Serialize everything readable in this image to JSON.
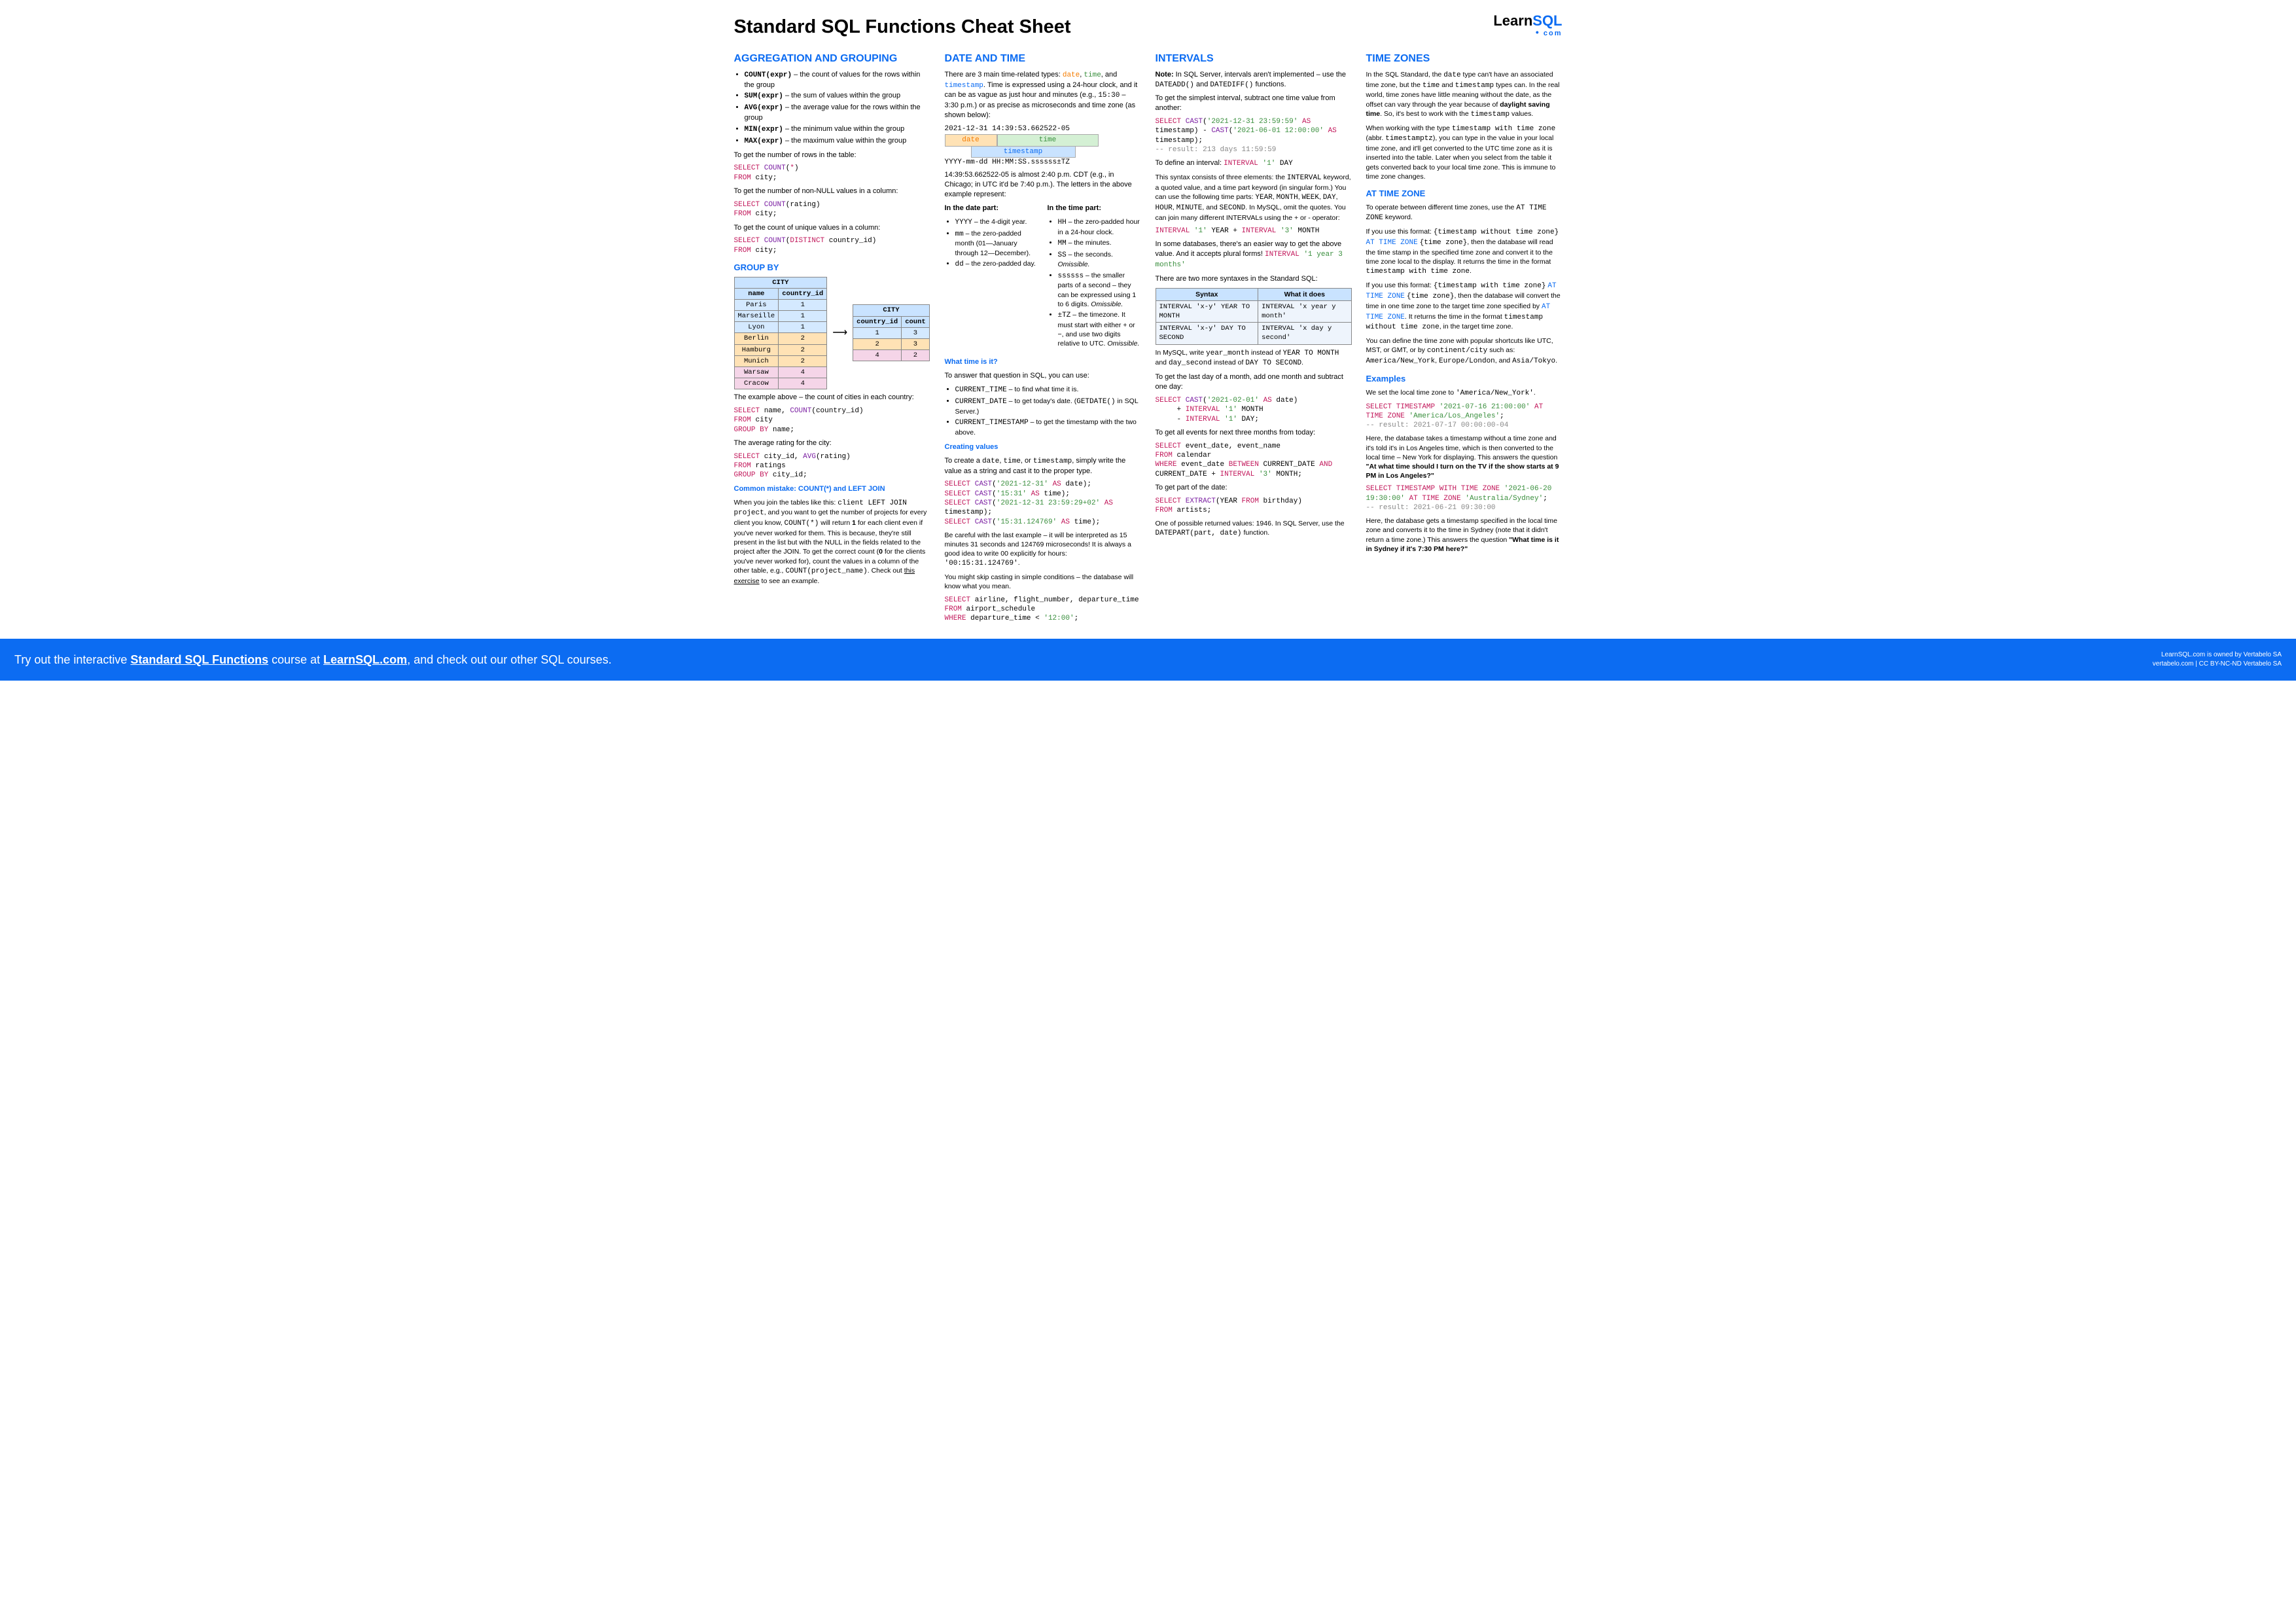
{
  "title": "Standard SQL Functions Cheat Sheet",
  "logo": {
    "learn": "Learn",
    "sql": "SQL",
    "com": "com"
  },
  "col1": {
    "h": "AGGREGATION AND GROUPING",
    "aggs": [
      {
        "fn": "COUNT(expr)",
        "d": " – the count of values for the rows within the group"
      },
      {
        "fn": "SUM(expr)",
        "d": " – the sum of values within the group"
      },
      {
        "fn": "AVG(expr)",
        "d": " – the average value for the rows within the group"
      },
      {
        "fn": "MIN(expr)",
        "d": " – the minimum value within the group"
      },
      {
        "fn": "MAX(expr)",
        "d": " – the maximum value within the group"
      }
    ],
    "p1": "To get the number of rows in the table:",
    "code1": "SELECT COUNT(*)\nFROM city;",
    "p2": "To get the number of non-NULL values in a column:",
    "code2": "SELECT COUNT(rating)\nFROM city;",
    "p3": "To get the count of unique values in a column:",
    "code3": "SELECT COUNT(DISTINCT country_id)\nFROM city;",
    "groupby_h": "GROUP BY",
    "city_h": "CITY",
    "name_h": "name",
    "cid_h": "country_id",
    "cnt_h": "count",
    "cities": [
      {
        "n": "Paris",
        "c": "1"
      },
      {
        "n": "Marseille",
        "c": "1"
      },
      {
        "n": "Lyon",
        "c": "1"
      },
      {
        "n": "Berlin",
        "c": "2"
      },
      {
        "n": "Hamburg",
        "c": "2"
      },
      {
        "n": "Munich",
        "c": "2"
      },
      {
        "n": "Warsaw",
        "c": "4"
      },
      {
        "n": "Cracow",
        "c": "4"
      }
    ],
    "grouped": [
      {
        "c": "1",
        "n": "3"
      },
      {
        "c": "2",
        "n": "3"
      },
      {
        "c": "4",
        "n": "2"
      }
    ],
    "p4": "The example above – the count of cities in each country:",
    "code4": "SELECT name, COUNT(country_id)\nFROM city\nGROUP BY name;",
    "p5": "The average rating for the city:",
    "code5": "SELECT city_id, AVG(rating)\nFROM ratings\nGROUP BY city_id;",
    "cm_h": "Common mistake: COUNT(*) and LEFT JOIN",
    "cm": "When you join the tables like this: client LEFT JOIN project, and you want to get the number of projects for every client you know, COUNT(*) will return 1 for each client even if you've never worked for them. This is because, they're still present in the list but with the NULL in the fields related to the project after the JOIN. To get the correct count (0 for the clients you've never worked for), count the values in a column of the other table, e.g., COUNT(project_name). Check out this exercise to see an example."
  },
  "col2": {
    "h": "DATE AND TIME",
    "intro": "There are 3 main time-related types: date, time, and timestamp. Time is expressed using a 24-hour clock, and it can be as vague as just hour and minutes (e.g., 15:30 – 3:30 p.m.) or as precise as microseconds and time zone (as shown below):",
    "ts": "2021-12-31 14:39:53.662522-05",
    "tsf": "YYYY-mm-dd HH:MM:SS.ssssss±TZ",
    "box": {
      "d": "date",
      "t": "time",
      "ts": "timestamp"
    },
    "p1": "14:39:53.662522-05 is almost 2:40 p.m. CDT (e.g., in Chicago; in UTC it'd be 7:40 p.m.). The letters in the above example represent:",
    "dp_h": "In the date part:",
    "tp_h": "In the time part:",
    "dp": [
      "YYYY – the 4-digit year.",
      "mm – the zero-padded month (01—January through 12—December).",
      "dd – the zero-padded day."
    ],
    "tp": [
      "HH – the zero-padded hour in a 24-hour clock.",
      "MM – the minutes.",
      "SS – the seconds. Omissible.",
      "ssssss – the smaller parts of a second – they can be expressed using 1 to 6 digits. Omissible.",
      "±TZ – the timezone. It must start with either + or −, and use two digits relative to UTC. Omissible."
    ],
    "wt_h": "What time is it?",
    "wt_p": "To answer that question in SQL, you can use:",
    "wt": [
      "CURRENT_TIME – to find what time it is.",
      "CURRENT_DATE – to get today's date. (GETDATE() in SQL Server.)",
      "CURRENT_TIMESTAMP – to get the timestamp with the two above."
    ],
    "cv_h": "Creating values",
    "cv_p": "To create a date, time, or timestamp, simply write the value as a string and cast it to the proper type.",
    "cv_code": "SELECT CAST('2021-12-31' AS date);\nSELECT CAST('15:31' AS time);\nSELECT CAST('2021-12-31 23:59:29+02' AS timestamp);\nSELECT CAST('15:31.124769' AS time);",
    "cv_p2": "Be careful with the last example – it will be interpreted as 15 minutes 31 seconds and 124769 microseconds! It is always a good idea to write 00 explicitly for hours: '00:15:31.124769'.",
    "cv_p3": "You might skip casting in simple conditions – the database will know what you mean.",
    "cv_code2": "SELECT airline, flight_number, departure_time\nFROM airport_schedule\nWHERE departure_time < '12:00';"
  },
  "col3": {
    "h": "INTERVALs",
    "note": "Note: In SQL Server, intervals aren't implemented – use the DATEADD() and DATEDIFF() functions.",
    "p1": "To get the simplest interval, subtract one time value from another:",
    "code1": "SELECT CAST('2021-12-31 23:59:59' AS timestamp) - CAST('2021-06-01 12:00:00' AS timestamp);\n-- result: 213 days 11:59:59",
    "p2a": "To define an interval:  ",
    "p2b": "INTERVAL '1' DAY",
    "p2": "This syntax consists of three elements: the INTERVAL keyword, a quoted value, and a time part keyword (in singular form.) You can use the following time parts: YEAR, MONTH, WEEK, DAY, HOUR, MINUTE, and SECOND. In MySQL, omit the quotes. You can join many different INTERVALs using the + or - operator:",
    "code2": "INTERVAL '1' YEAR + INTERVAL '3' MONTH",
    "p3": "In some databases, there's an easier way to get the above value. And it accepts plural forms! ",
    "code3": "INTERVAL '1 year 3 months'",
    "p4": "There are two more syntaxes in the Standard SQL:",
    "syn_h1": "Syntax",
    "syn_h2": "What it does",
    "syn": [
      {
        "a": "INTERVAL 'x-y' YEAR TO MONTH",
        "b": "INTERVAL 'x year y month'"
      },
      {
        "a": "INTERVAL 'x-y' DAY TO SECOND",
        "b": "INTERVAL 'x day y second'"
      }
    ],
    "p5": "In MySQL, write year_month instead of YEAR TO MONTH and day_second instead of DAY TO SECOND.",
    "p6": "To get the last day of a month, add one month and subtract one day:",
    "code6": "SELECT CAST('2021-02-01' AS date)\n     + INTERVAL '1' MONTH\n     - INTERVAL '1' DAY;",
    "p7": "To get all events for next three months from today:",
    "code7": "SELECT event_date, event_name\nFROM calendar\nWHERE event_date BETWEEN CURRENT_DATE AND CURRENT_DATE + INTERVAL '3' MONTH;",
    "p8": "To get part of the date:",
    "code8": "SELECT EXTRACT(YEAR FROM birthday)\nFROM artists;",
    "p9": "One of possible returned values: 1946. In SQL Server, use the DATEPART(part, date) function."
  },
  "col4": {
    "h": "TIME ZONES",
    "p1": "In the SQL Standard, the date type can't have an associated time zone, but the time and timestamp types can. In the real world, time zones have little meaning without the date, as the offset can vary through the year because of daylight saving time. So, it's best to work with the timestamp values.",
    "p2": "When working with the type timestamp with time zone (abbr. timestamptz), you can type in the value in your local time zone, and it'll get converted to the UTC time zone as it is inserted into the table. Later when you select from the table it gets converted back to your local time zone. This is immune to time zone changes.",
    "atz_h": "AT TIME ZONE",
    "atz_p": "To operate between different time zones, use the AT TIME ZONE keyword.",
    "atz1": "If you use this format: {timestamp without time zone} AT TIME ZONE {time zone}, then the database will read the time stamp in the specified time zone and convert it to the time zone local to the display. It returns the time in the format timestamp with time zone.",
    "atz2": "If you use this format: {timestamp with time zone} AT TIME ZONE {time zone}, then the database will convert the time in one time zone to the target time zone specified by AT TIME ZONE. It returns the time in the format timestamp without time zone, in the target time zone.",
    "atz3": "You can define the time zone with popular shortcuts like UTC, MST, or GMT, or by continent/city such as: America/New_York, Europe/London, and Asia/Tokyo.",
    "ex_h": "Examples",
    "ex_p": "We set the local time zone to 'America/New_York'.",
    "ex1": "SELECT TIMESTAMP '2021-07-16 21:00:00' AT TIME ZONE 'America/Los_Angeles';\n-- result: 2021-07-17 00:00:00-04",
    "ex1d": "Here, the database takes a timestamp without a time zone and it's told it's in Los Angeles time, which is then converted to the local time – New York for displaying. This answers the question \"At what time should I turn on the TV if the show starts at 9 PM in Los Angeles?\"",
    "ex2": "SELECT TIMESTAMP WITH TIME ZONE '2021-06-20 19:30:00' AT TIME ZONE 'Australia/Sydney';\n-- result: 2021-06-21 09:30:00",
    "ex2d": "Here, the database gets a timestamp specified in the local time zone and converts it to the time in Sydney (note that it didn't return a time zone.) This answers the question \"What time is it in Sydney if it's 7:30 PM here?\""
  },
  "footer": {
    "text1": "Try out the interactive ",
    "link1": "Standard SQL Functions",
    "text2": " course at ",
    "link2": "LearnSQL.com",
    "text3": ", and check out our other SQL courses.",
    "r1": "LearnSQL.com is owned by Vertabelo SA",
    "r2": "vertabelo.com | CC BY-NC-ND Vertabelo SA"
  }
}
